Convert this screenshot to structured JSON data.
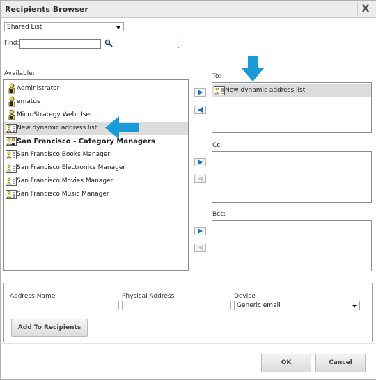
{
  "dialog": {
    "title": "Recipients Browser",
    "close_label": "X"
  },
  "source_select": {
    "value": "Shared List"
  },
  "find": {
    "label": "Find:",
    "value": ""
  },
  "available": {
    "label": "Available:",
    "items": [
      {
        "label": "Administrator",
        "icon": "user-icon",
        "bold": false,
        "selected": false
      },
      {
        "label": "ematus",
        "icon": "user-icon",
        "bold": false,
        "selected": false
      },
      {
        "label": "MicroStrategy Web User",
        "icon": "user-icon",
        "bold": false,
        "selected": false
      },
      {
        "label": "New dynamic address list",
        "icon": "dynamic-list-icon",
        "bold": false,
        "selected": true
      },
      {
        "label": "San Francisco - Category Managers",
        "icon": "group-icon",
        "bold": true,
        "selected": false
      },
      {
        "label": "San Francisco Books Manager",
        "icon": "contact-icon",
        "bold": false,
        "selected": false
      },
      {
        "label": "San Francisco Electronics Manager",
        "icon": "contact-icon",
        "bold": false,
        "selected": false
      },
      {
        "label": "San Francisco Movies Manager",
        "icon": "contact-icon",
        "bold": false,
        "selected": false
      },
      {
        "label": "San Francisco Music Manager",
        "icon": "contact-icon",
        "bold": false,
        "selected": false
      }
    ]
  },
  "to": {
    "label": "To:",
    "items": [
      {
        "label": "New dynamic address list",
        "icon": "dynamic-list-icon",
        "selected": true
      }
    ]
  },
  "cc": {
    "label": "Cc:",
    "items": []
  },
  "bcc": {
    "label": "Bcc:",
    "items": []
  },
  "address_form": {
    "address_name_label": "Address Name",
    "address_name_value": "",
    "physical_address_label": "Physical Address",
    "physical_address_value": "",
    "device_label": "Device",
    "device_value": "Generic email",
    "add_button": "Add To Recipients"
  },
  "footer": {
    "ok_label": "OK",
    "cancel_label": "Cancel"
  },
  "colors": {
    "annotation_arrow": "#1a9ad6",
    "selected_row": "#dcdcdc"
  }
}
